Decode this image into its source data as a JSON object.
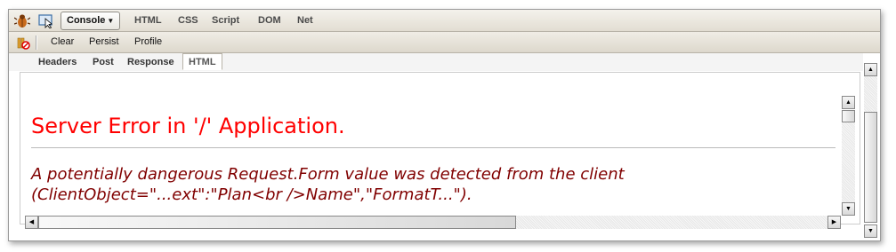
{
  "toolbar": {
    "console_label": "Console",
    "tabs": [
      "HTML",
      "CSS",
      "Script",
      "DOM",
      "Net"
    ]
  },
  "console_toolbar": {
    "clear_label": "Clear",
    "persist_label": "Persist",
    "profile_label": "Profile"
  },
  "net_subtabs": [
    "Headers",
    "Post",
    "Response",
    "HTML"
  ],
  "active_subtab": "HTML",
  "error": {
    "title": "Server Error in '/' Application.",
    "message_line1": "A potentially dangerous Request.Form value was detected from the client",
    "message_line2": "(ClientObject=\"...ext\":\"Plan<br />Name\",\"FormatT...\")."
  },
  "icons": {
    "firebug": "firebug-icon",
    "inspect": "inspect-icon",
    "clear": "clear-console-icon"
  }
}
